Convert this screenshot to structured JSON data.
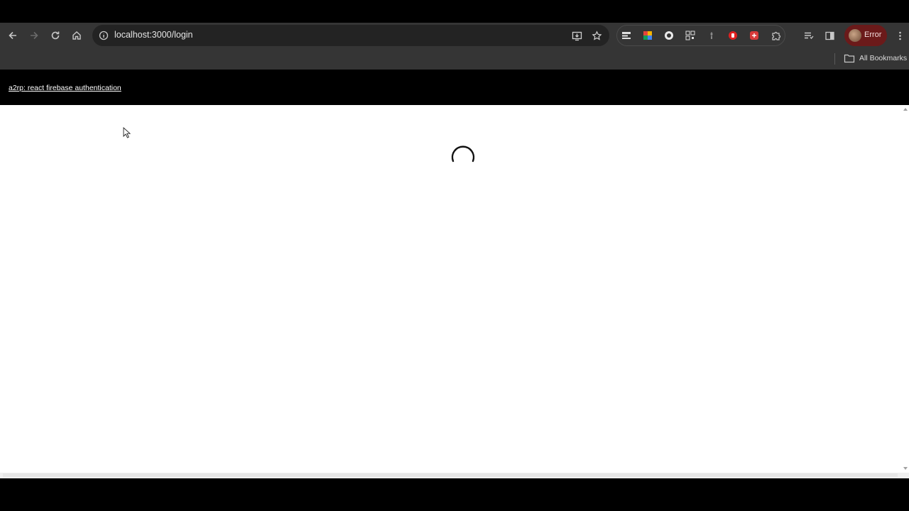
{
  "browser": {
    "url": "localhost:3000/login",
    "profile_status": "Error",
    "bookmarks_label": "All Bookmarks",
    "icons": {
      "back": "back-arrow-icon",
      "forward": "forward-arrow-icon",
      "reload": "reload-icon",
      "home": "home-icon",
      "site_info": "info-icon",
      "install": "install-app-icon",
      "bookmark_star": "star-icon",
      "extensions": "puzzle-icon",
      "reading_list": "reading-list-icon",
      "side_panel": "side-panel-icon",
      "menu": "kebab-menu-icon",
      "folder": "folder-icon"
    },
    "colors": {
      "toolbar": "#353535",
      "omnibox": "#232323",
      "profile_chip": "#6b1a1a"
    }
  },
  "page": {
    "header_link": "a2rp: react firebase authentication",
    "state": "loading"
  }
}
